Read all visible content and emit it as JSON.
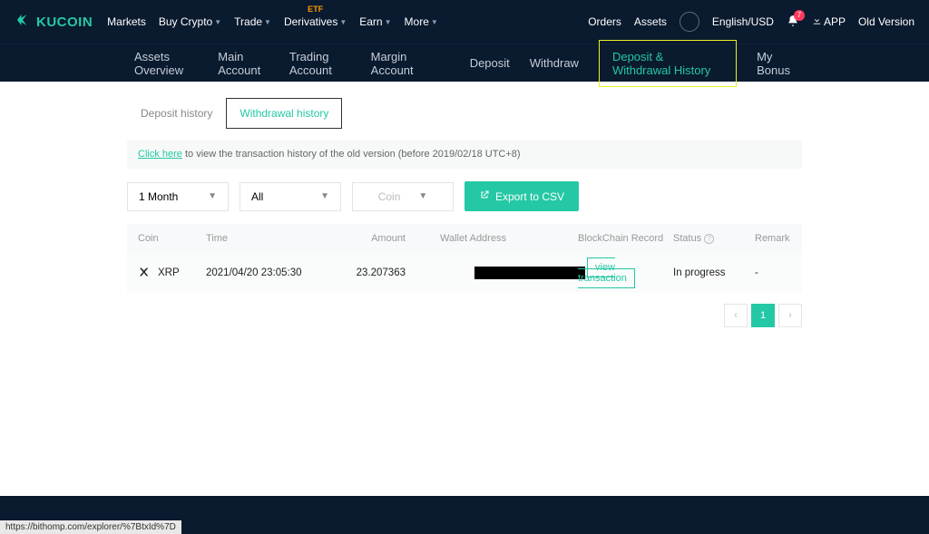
{
  "header": {
    "logo_text": "KUCOIN",
    "nav": {
      "markets": "Markets",
      "buy_crypto": "Buy Crypto",
      "trade": "Trade",
      "derivatives": "Derivatives",
      "derivatives_badge": "ETF",
      "earn": "Earn",
      "more": "More"
    },
    "right": {
      "orders": "Orders",
      "assets": "Assets",
      "lang": "English/USD",
      "notif_count": "7",
      "app": "APP",
      "old_version": "Old Version"
    }
  },
  "subnav": {
    "assets_overview": "Assets Overview",
    "main_account": "Main Account",
    "trading_account": "Trading Account",
    "margin_account": "Margin Account",
    "deposit": "Deposit",
    "withdraw": "Withdraw",
    "history": "Deposit & Withdrawal History",
    "my_bonus": "My Bonus"
  },
  "tabs": {
    "deposit_history": "Deposit history",
    "withdrawal_history": "Withdrawal history"
  },
  "notice": {
    "link": "Click here",
    "text": " to view the transaction history of the old version (before 2019/02/18 UTC+8)"
  },
  "filters": {
    "period": "1 Month",
    "coin_filter": "All",
    "coin_placeholder": "Coin",
    "export": "Export to CSV"
  },
  "table": {
    "headers": {
      "coin": "Coin",
      "time": "Time",
      "amount": "Amount",
      "wallet": "Wallet Address",
      "blockchain": "BlockChain Record",
      "status": "Status",
      "remark": "Remark"
    },
    "rows": [
      {
        "coin": "XRP",
        "time": "2021/04/20 23:05:30",
        "amount": "23.207363",
        "view_tx": "view transaction",
        "status": "In progress",
        "remark": "-"
      }
    ]
  },
  "pagination": {
    "current": "1"
  },
  "status_bar": "https://bithomp.com/explorer/%7BtxId%7D"
}
